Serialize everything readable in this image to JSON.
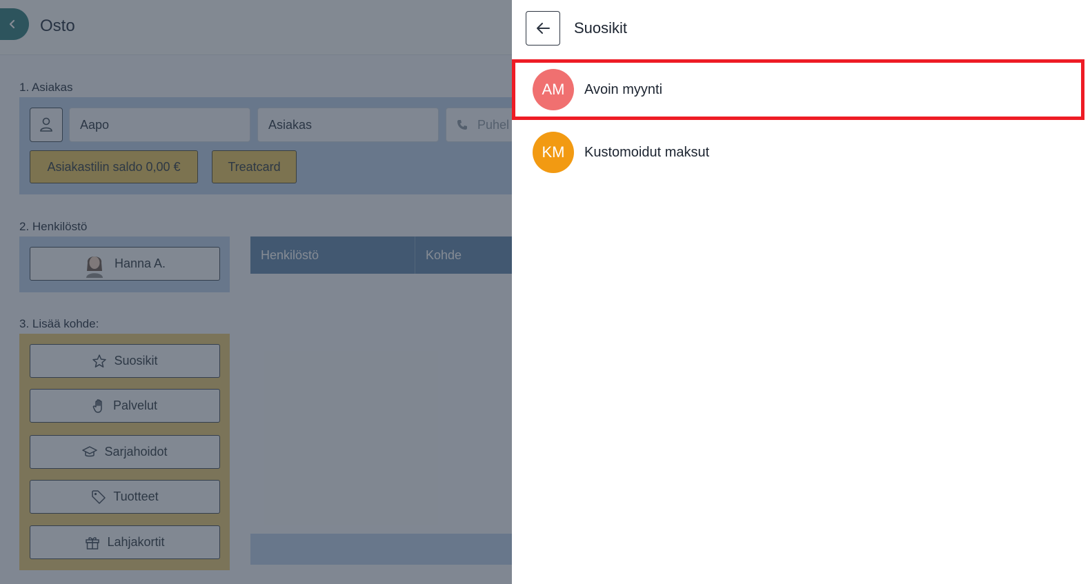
{
  "app": {
    "title": "Osto",
    "back_icon": "chevron-left-icon"
  },
  "customer": {
    "section_label": "1. Asiakas",
    "person_icon": "user-icon",
    "first_name": "Aapo",
    "last_name": "Asiakas",
    "phone_placeholder": "Puhel",
    "phone_icon": "phone-icon",
    "balance_label": "Asiakastilin saldo 0,00 €",
    "treatcard_label": "Treatcard"
  },
  "staff": {
    "section_label": "2. Henkilöstö",
    "selected_staff": "Hanna A."
  },
  "add_item": {
    "section_label": "3. Lisää kohde:",
    "buttons": [
      {
        "label": "Suosikit",
        "icon": "star-icon"
      },
      {
        "label": "Palvelut",
        "icon": "hand-icon"
      },
      {
        "label": "Sarjahoidot",
        "icon": "graduation-cap-icon"
      },
      {
        "label": "Tuotteet",
        "icon": "tag-icon"
      },
      {
        "label": "Lahjakortit",
        "icon": "gift-icon"
      }
    ]
  },
  "table": {
    "columns": [
      "Henkilöstö",
      "Kohde"
    ]
  },
  "drawer": {
    "title": "Suosikit",
    "back_icon": "arrow-left-icon",
    "items": [
      {
        "initials": "AM",
        "label": "Avoin myynti",
        "color": "#f07070",
        "highlighted": true
      },
      {
        "initials": "KM",
        "label": "Kustomoidut maksut",
        "color": "#f29a12",
        "highlighted": false
      }
    ]
  },
  "colors": {
    "highlight": "#ee1c25",
    "accent_teal": "#2f7d7d",
    "gold": "#e9c75d",
    "table_header": "#5f87ad"
  }
}
